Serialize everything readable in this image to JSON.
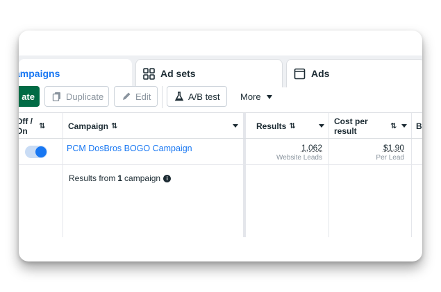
{
  "tabs": {
    "campaigns": "ampaigns",
    "adsets": "Ad sets",
    "ads": "Ads"
  },
  "toolbar": {
    "create_label": "ate",
    "duplicate_label": "Duplicate",
    "edit_label": "Edit",
    "ab_test_label": "A/B test",
    "more_label": "More"
  },
  "table": {
    "headers": {
      "off_on_line1": "Off /",
      "off_on_line2": "On",
      "campaign": "Campaign",
      "results": "Results",
      "cost_line1": "Cost per",
      "cost_line2": "result",
      "next": "B"
    },
    "row": {
      "campaign_name": "PCM DosBros BOGO Campaign",
      "results_value": "1,062",
      "results_sub": "Website Leads",
      "cost_value": "$1.90",
      "cost_sub": "Per Lead"
    },
    "summary": {
      "prefix": "Results from",
      "count": "1",
      "suffix": "campaign"
    }
  },
  "colors": {
    "accent": "#1877f2",
    "create_button": "#006b45"
  }
}
